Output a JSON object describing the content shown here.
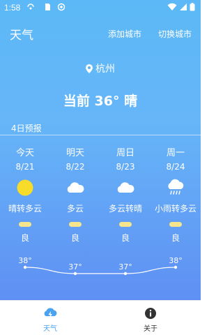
{
  "status_bar": {
    "time": "1:58"
  },
  "toolbar": {
    "title": "天气",
    "add_city_label": "添加城市",
    "switch_city_label": "切换城市"
  },
  "location": {
    "city": "杭州"
  },
  "current": {
    "text": "当前 36° 晴"
  },
  "forecast": {
    "label": "4日预报",
    "days": [
      {
        "name": "今天",
        "date": "8/21",
        "icon": "sun-icon",
        "desc": "晴转多云",
        "aqi": "良",
        "temp": 38,
        "temp_label": "38°"
      },
      {
        "name": "明天",
        "date": "8/22",
        "icon": "cloud-icon",
        "desc": "多云",
        "aqi": "良",
        "temp": 37,
        "temp_label": "37°"
      },
      {
        "name": "周日",
        "date": "8/23",
        "icon": "cloud-icon",
        "desc": "多云转晴",
        "aqi": "良",
        "temp": 37,
        "temp_label": "37°"
      },
      {
        "name": "周一",
        "date": "8/24",
        "icon": "rain-cloud-icon",
        "desc": "小雨转多云",
        "aqi": "良",
        "temp": 38,
        "temp_label": "38°"
      }
    ]
  },
  "tabbar": {
    "weather_label": "天气",
    "about_label": "关于"
  },
  "colors": {
    "accent": "#4aa3f0",
    "sun": "#f7dd2a",
    "aqi_good": "#f6e58a",
    "tab_inactive": "#333333"
  }
}
